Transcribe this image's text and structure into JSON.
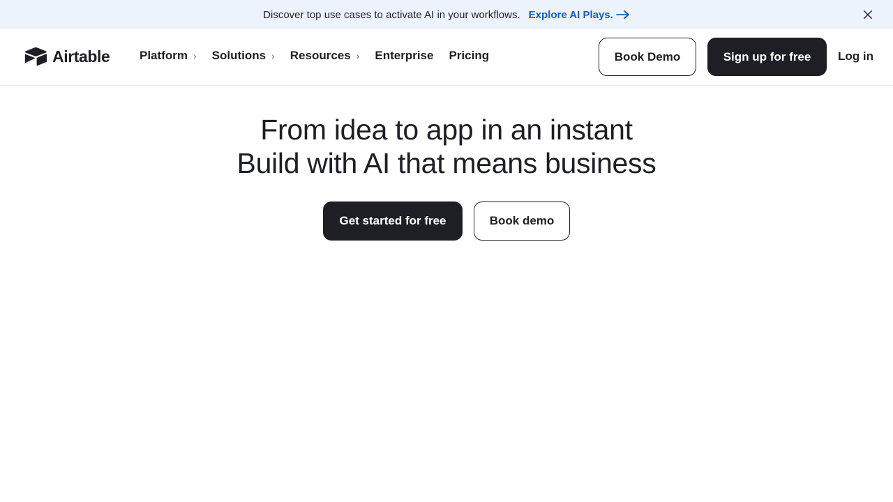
{
  "banner": {
    "message": "Discover top use cases to activate AI in your workflows.",
    "cta": "Explore AI Plays.",
    "cta_icon": "arrow-right-icon",
    "close_icon": "close-icon",
    "background": "#edf3fd",
    "link_color": "#1c5ba8"
  },
  "nav": {
    "logo_text": "Airtable",
    "logo_icon": "airtable-logo-icon",
    "items": [
      {
        "label": "Platform",
        "has_submenu": true
      },
      {
        "label": "Solutions",
        "has_submenu": true
      },
      {
        "label": "Resources",
        "has_submenu": true
      },
      {
        "label": "Enterprise",
        "has_submenu": false
      },
      {
        "label": "Pricing",
        "has_submenu": false
      }
    ],
    "book_demo": "Book Demo",
    "signup": "Sign up for free",
    "login": "Log in"
  },
  "hero": {
    "line1": "From idea to app in an instant",
    "line2": "Build with AI that means business",
    "primary_cta": "Get started for free",
    "secondary_cta": "Book demo"
  },
  "colors": {
    "text": "#1d1f25",
    "dark_button": "#1d1f25"
  }
}
